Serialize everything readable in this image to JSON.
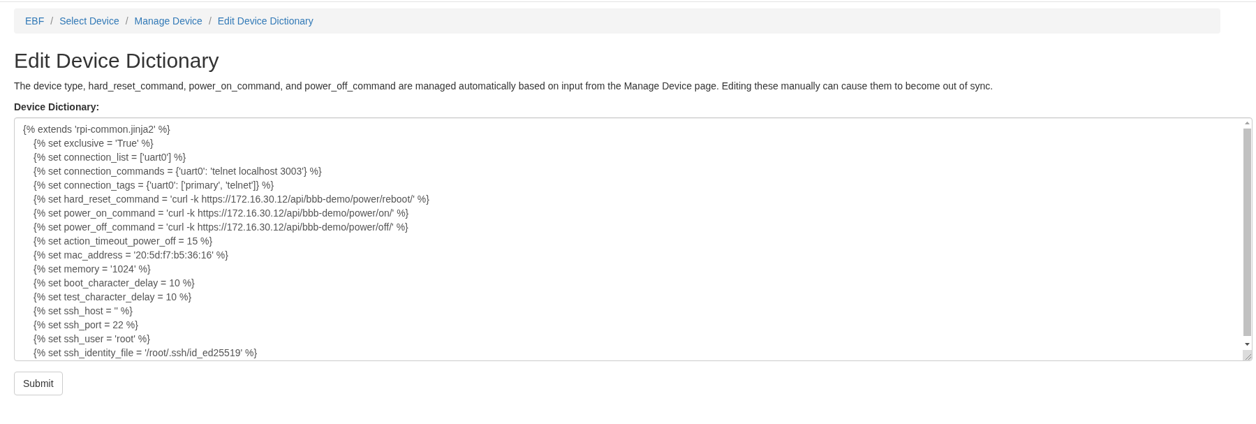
{
  "breadcrumb": [
    {
      "label": "EBF"
    },
    {
      "separator": "/",
      "label": "Select Device"
    },
    {
      "separator": "/",
      "label": "Manage Device"
    },
    {
      "separator": "/",
      "label": "Edit Device Dictionary"
    }
  ],
  "title": "Edit Device Dictionary",
  "description": "The device type, hard_reset_command, power_on_command, and power_off_command are managed automatically based on input from the Manage Device page. Editing these manually can cause them to become out of sync.",
  "dictionary": {
    "label": "Device Dictionary:",
    "lines": [
      {
        "text": "{% extends 'rpi-common.jinja2' %}",
        "children": [
          {
            "text": "{% set exclusive = 'True' %}"
          },
          {
            "text": "{% set connection_list = ['uart0'] %}"
          },
          {
            "text": "{% set connection_commands = {'uart0': 'telnet localhost 3003'} %}"
          },
          {
            "text": "{% set connection_tags = {'uart0': ['primary', 'telnet']} %}"
          },
          {
            "text": "{% set hard_reset_command = 'curl -k https://172.16.30.12/api/bbb-demo/power/reboot/' %}"
          },
          {
            "text": "{% set power_on_command = 'curl -k https://172.16.30.12/api/bbb-demo/power/on/' %}"
          },
          {
            "text": "{% set power_off_command = 'curl -k https://172.16.30.12/api/bbb-demo/power/off/' %}"
          },
          {
            "text": "{% set action_timeout_power_off = 15 %}"
          },
          {
            "text": "{% set mac_address = '20:5d:f7:b5:36:16' %}"
          },
          {
            "text": "{% set memory = '1024' %}"
          },
          {
            "text": "{% set boot_character_delay = 10 %}"
          },
          {
            "text": "{% set test_character_delay = 10 %}"
          },
          {
            "text": "{% set ssh_host = '' %}"
          },
          {
            "text": "{% set ssh_port = 22 %}"
          },
          {
            "text": "{% set ssh_user = 'root' %}"
          },
          {
            "text": "{% set ssh_identity_file = '/root/.ssh/id_ed25519' %}"
          }
        ]
      }
    ]
  },
  "submit_button": {
    "label": "Submit"
  }
}
